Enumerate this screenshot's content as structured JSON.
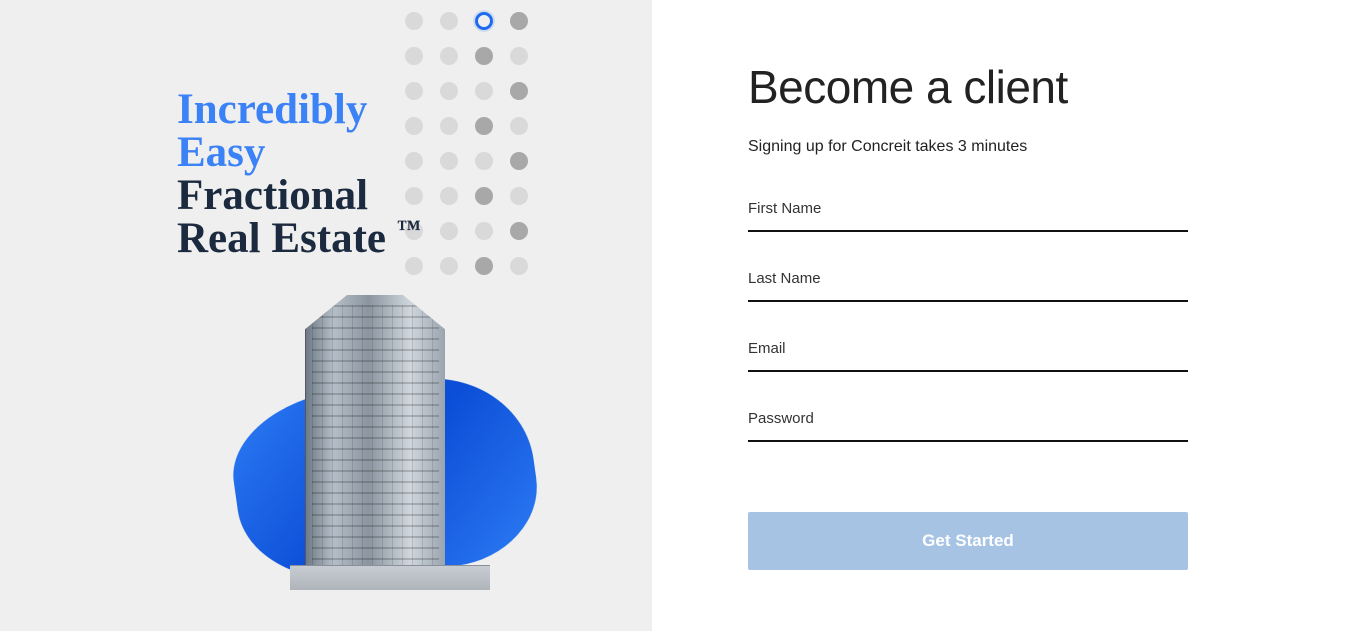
{
  "left": {
    "headline_line1": "Incredibly",
    "headline_line2": "Easy",
    "headline_line3": "Fractional",
    "headline_line4": "Real Estate",
    "trademark": "™"
  },
  "form": {
    "title": "Become a client",
    "subtitle": "Signing up for Concreit takes 3 minutes",
    "first_name_label": "First Name",
    "first_name_value": "",
    "last_name_label": "Last Name",
    "last_name_value": "",
    "email_label": "Email",
    "email_value": "",
    "password_label": "Password",
    "password_value": "",
    "submit_label": "Get Started"
  },
  "colors": {
    "accent_blue": "#3b82f6",
    "dark_text": "#1b2a3e",
    "button_bg": "#a6c3e4"
  }
}
